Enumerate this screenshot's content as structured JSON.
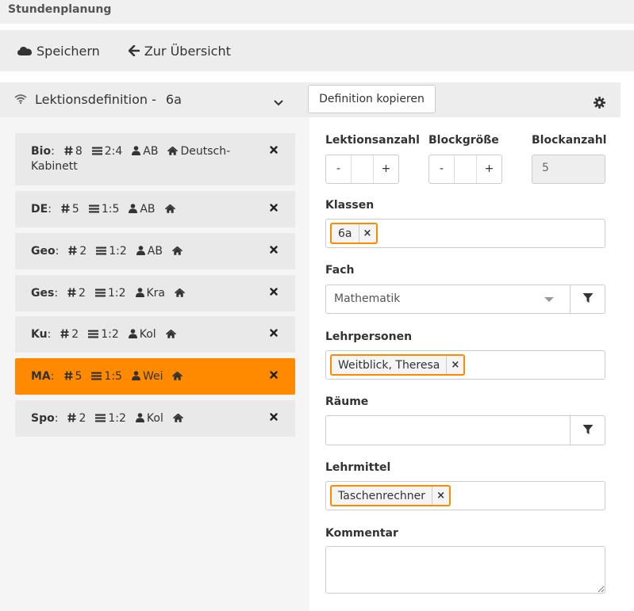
{
  "app": {
    "title": "Stundenplanung"
  },
  "toolbar": {
    "save_label": "Speichern",
    "overview_label": "Zur Übersicht"
  },
  "panel": {
    "title": "Lektionsdefinition -",
    "class_name": "6a",
    "copy_button": "Definition kopieren"
  },
  "lessons": [
    {
      "subject": "Bio",
      "count": "8",
      "block": "2:4",
      "teacher": "AB",
      "room_line1": "Deutsch-",
      "room_line2": "Kabinett",
      "active": false
    },
    {
      "subject": "DE",
      "count": "5",
      "block": "1:5",
      "teacher": "AB",
      "room_line1": "",
      "active": false
    },
    {
      "subject": "Geo",
      "count": "2",
      "block": "1:2",
      "teacher": "AB",
      "room_line1": "",
      "active": false
    },
    {
      "subject": "Ges",
      "count": "2",
      "block": "1:2",
      "teacher": "Kra",
      "room_line1": "",
      "active": false
    },
    {
      "subject": "Ku",
      "count": "2",
      "block": "1:2",
      "teacher": "Kol",
      "room_line1": "",
      "active": false
    },
    {
      "subject": "MA",
      "count": "5",
      "block": "1:5",
      "teacher": "Wei",
      "room_line1": "",
      "active": true
    },
    {
      "subject": "Spo",
      "count": "2",
      "block": "1:2",
      "teacher": "Kol",
      "room_line1": "",
      "active": false
    }
  ],
  "form": {
    "lektionsanzahl_label": "Lektionsanzahl",
    "blockgroesse_label": "Blockgröße",
    "blockanzahl_label": "Blockanzahl",
    "blockanzahl_value": "5",
    "minus": "-",
    "plus": "+",
    "klassen_label": "Klassen",
    "klassen_tag": "6a",
    "fach_label": "Fach",
    "fach_value": "Mathematik",
    "lehrpersonen_label": "Lehrpersonen",
    "lehrpersonen_tag": "Weitblick, Theresa",
    "raeume_label": "Räume",
    "lehrmittel_label": "Lehrmittel",
    "lehrmittel_tag": "Taschenrechner",
    "kommentar_label": "Kommentar",
    "tag_remove": "×"
  },
  "colors": {
    "accent": "#ff8a00",
    "card_bg": "#e9e9e9",
    "toolbar_bg": "#ededed"
  },
  "icons": [
    "cloud-icon",
    "arrow-left-icon",
    "wifi-icon",
    "chevron-down-icon",
    "gear-icon",
    "hash-icon",
    "list-icon",
    "user-icon",
    "home-icon",
    "close-icon",
    "filter-icon"
  ]
}
